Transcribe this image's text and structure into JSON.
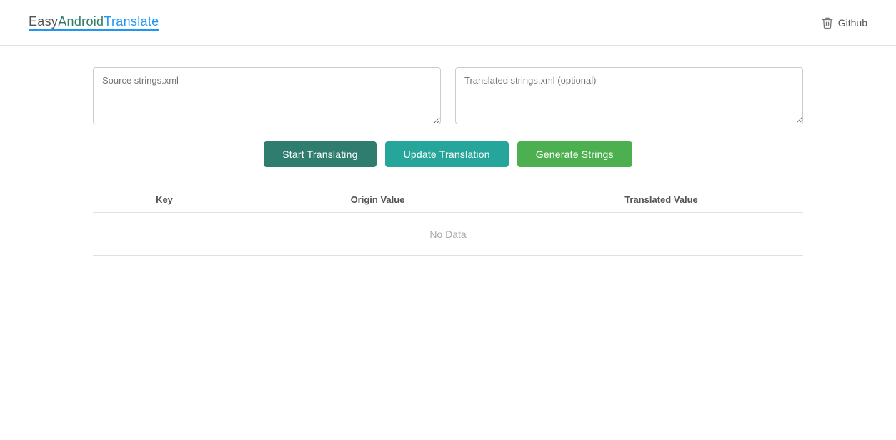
{
  "brand": {
    "easy": "Easy",
    "android": "Android",
    "translate": "Translate"
  },
  "github": {
    "label": "Github",
    "icon": "trash-icon"
  },
  "textareas": {
    "source_placeholder": "Source strings.xml",
    "translated_placeholder": "Translated strings.xml (optional)"
  },
  "buttons": {
    "start": "Start Translating",
    "update": "Update Translation",
    "generate": "Generate Strings"
  },
  "table": {
    "col_key": "Key",
    "col_origin": "Origin Value",
    "col_translated": "Translated Value",
    "no_data": "No Data"
  }
}
